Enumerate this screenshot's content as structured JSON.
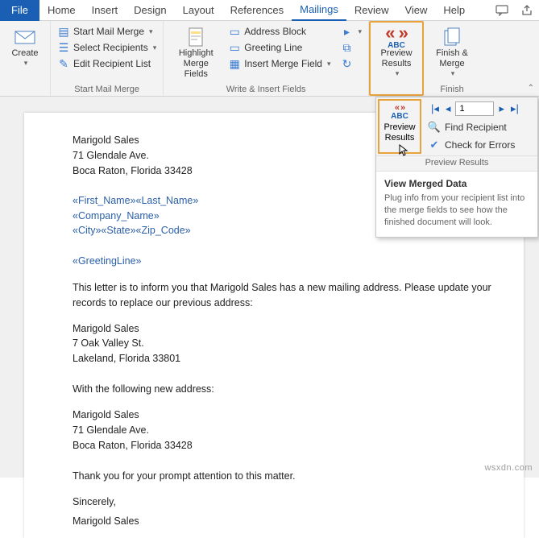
{
  "tabs": {
    "file": "File",
    "home": "Home",
    "insert": "Insert",
    "design": "Design",
    "layout": "Layout",
    "references": "References",
    "mailings": "Mailings",
    "review": "Review",
    "view": "View",
    "help": "Help"
  },
  "ribbon": {
    "create": {
      "label": "Create"
    },
    "start_merge": {
      "start": "Start Mail Merge",
      "select": "Select Recipients",
      "edit": "Edit Recipient List",
      "group": "Start Mail Merge"
    },
    "highlight": {
      "label": "Highlight Merge Fields"
    },
    "write_insert": {
      "address": "Address Block",
      "greeting": "Greeting Line",
      "insert_field": "Insert Merge Field",
      "group": "Write & Insert Fields"
    },
    "preview": {
      "label": "Preview Results"
    },
    "finish": {
      "label": "Finish & Merge",
      "group": "Finish"
    }
  },
  "popover": {
    "abc": "ABC",
    "preview": "Preview Results",
    "record_value": "1",
    "find": "Find Recipient",
    "check": "Check for Errors",
    "footer": "Preview Results",
    "tt_title": "View Merged Data",
    "tt_body": "Plug info from your recipient list into the merge fields to see how the finished document will look."
  },
  "doc": {
    "sender": {
      "name": "Marigold Sales",
      "street": "71 Glendale Ave.",
      "csz": "Boca Raton, Florida 33428"
    },
    "fields": {
      "line1": "«First_Name»«Last_Name»",
      "line2": "«Company_Name»",
      "line3": "«City»«State»«Zip_Code»",
      "greeting": "«GreetingLine»"
    },
    "body1": "This letter is to inform you that Marigold Sales has a new mailing address. Please update your records to replace our previous address:",
    "addr2": {
      "name": "Marigold Sales",
      "street": "7 Oak Valley St.",
      "csz": "Lakeland, Florida 33801"
    },
    "body2": "With the following new address:",
    "addr3": {
      "name": "Marigold Sales",
      "street": "71 Glendale Ave.",
      "csz": "Boca Raton, Florida 33428"
    },
    "thanks": "Thank you for your prompt attention to this matter.",
    "closing": "Sincerely,",
    "sig": "Marigold Sales"
  },
  "watermark": "wsxdn.com"
}
